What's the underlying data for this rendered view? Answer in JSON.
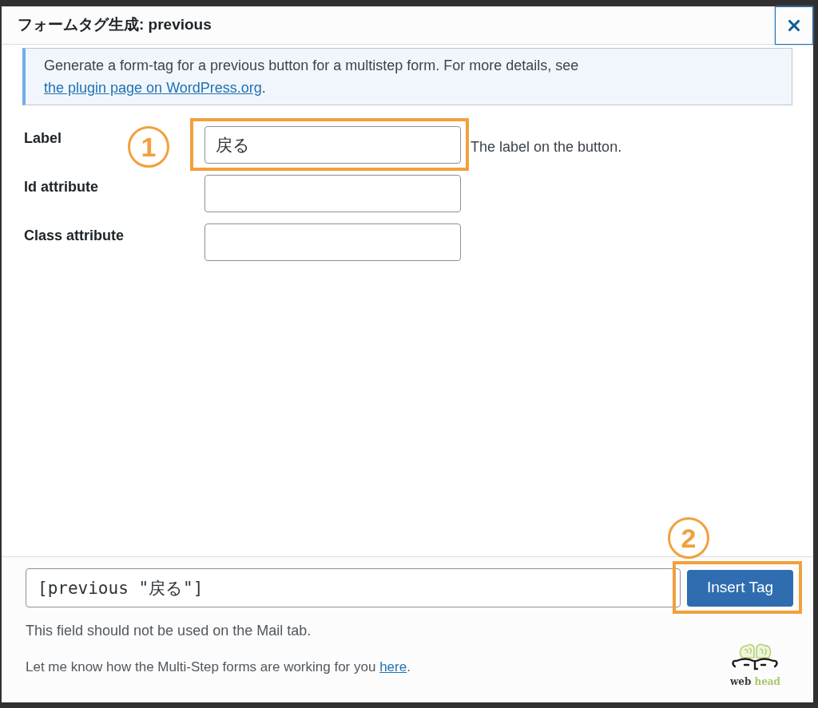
{
  "dialog": {
    "title": "フォームタグ生成: previous"
  },
  "notice": {
    "text": "Generate a form-tag for a previous button for a multistep form. For more details, see ",
    "link": "the plugin page on WordPress.org",
    "after": "."
  },
  "fields": [
    {
      "label": "Label",
      "value": "戻る",
      "description": "The label on the button.",
      "highlighted": true,
      "marker": "1"
    },
    {
      "label": "Id attribute",
      "highlighted": false
    },
    {
      "label": "Class attribute",
      "highlighted": false
    }
  ],
  "footer": {
    "tag_value": "[previous \"戻る\"]",
    "insert_button": {
      "label": "Insert Tag",
      "highlighted": true,
      "marker": "2"
    },
    "mail_note": "This field should not be used on the Mail tab.",
    "feedback": {
      "text": "Let me know how the Multi-Step forms are working for you ",
      "link": "here",
      "after": "."
    },
    "logo": {
      "word_1": "web",
      "word_2": "head"
    }
  }
}
